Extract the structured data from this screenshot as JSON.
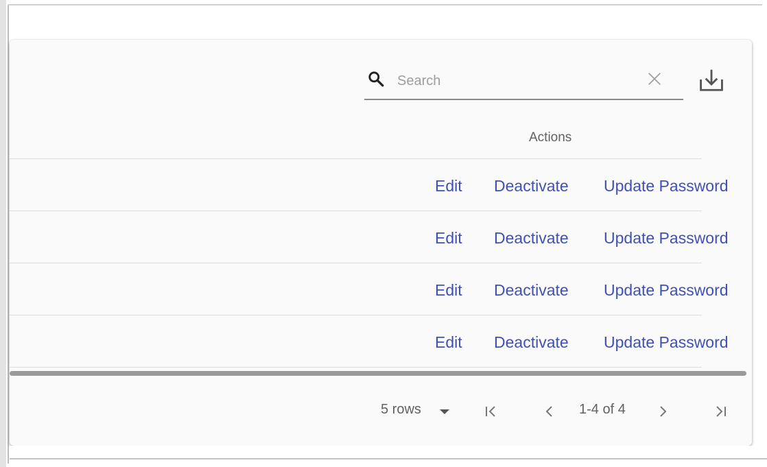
{
  "toolbar": {
    "search_placeholder": "Search",
    "search_value": ""
  },
  "table": {
    "actions_header": "Actions",
    "rows": [
      {
        "edit": "Edit",
        "deactivate": "Deactivate",
        "update_password": "Update Password"
      },
      {
        "edit": "Edit",
        "deactivate": "Deactivate",
        "update_password": "Update Password"
      },
      {
        "edit": "Edit",
        "deactivate": "Deactivate",
        "update_password": "Update Password"
      },
      {
        "edit": "Edit",
        "deactivate": "Deactivate",
        "update_password": "Update Password"
      }
    ]
  },
  "pagination": {
    "rows_per_page": "5 rows",
    "page_info": "1-4 of 4"
  },
  "icons": {
    "search": "search-icon",
    "clear": "close-icon",
    "download": "download-icon",
    "rows_dropdown": "caret-down-icon",
    "first": "first-page-icon",
    "prev": "chevron-left-icon",
    "next": "chevron-right-icon",
    "last": "last-page-icon"
  },
  "colors": {
    "link": "#3f51b5",
    "card_background": "#fafafa"
  }
}
